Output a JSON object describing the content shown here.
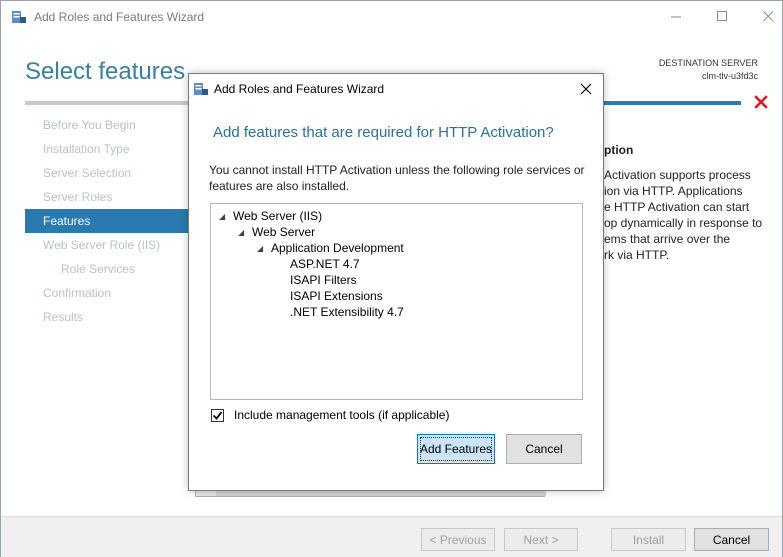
{
  "window": {
    "title": "Add Roles and Features Wizard",
    "controls": {
      "minimize": "minimize-icon",
      "maximize": "maximize-icon",
      "close": "close-icon"
    }
  },
  "header": {
    "page_title": "Select features",
    "destination_label": "DESTINATION SERVER",
    "destination_server": "clm-tlv-u3fd3c"
  },
  "nav": {
    "items": [
      {
        "label": "Before You Begin",
        "active": false,
        "sub": false
      },
      {
        "label": "Installation Type",
        "active": false,
        "sub": false
      },
      {
        "label": "Server Selection",
        "active": false,
        "sub": false
      },
      {
        "label": "Server Roles",
        "active": false,
        "sub": false
      },
      {
        "label": "Features",
        "active": true,
        "sub": false
      },
      {
        "label": "Web Server Role (IIS)",
        "active": false,
        "sub": false
      },
      {
        "label": "Role Services",
        "active": false,
        "sub": true
      },
      {
        "label": "Confirmation",
        "active": false,
        "sub": false
      },
      {
        "label": "Results",
        "active": false,
        "sub": false
      }
    ]
  },
  "description": {
    "title": "ption",
    "lines": [
      "Activation supports process",
      "ion via HTTP. Applications",
      "e HTTP Activation can start",
      "op dynamically in response to",
      "ems that arrive over the",
      "rk via HTTP."
    ]
  },
  "footer": {
    "previous": "< Previous",
    "next": "Next >",
    "install": "Install",
    "cancel": "Cancel"
  },
  "dialog": {
    "title": "Add Roles and Features Wizard",
    "heading": "Add features that are required for HTTP Activation?",
    "text": "You cannot install HTTP Activation unless the following role services or features are also installed.",
    "tree": [
      {
        "label": "Web Server (IIS)",
        "expandable": true
      },
      {
        "label": "Web Server",
        "expandable": true
      },
      {
        "label": "Application Development",
        "expandable": true
      },
      {
        "label": "ASP.NET 4.7",
        "expandable": false
      },
      {
        "label": "ISAPI Filters",
        "expandable": false
      },
      {
        "label": "ISAPI Extensions",
        "expandable": false
      },
      {
        "label": ".NET Extensibility 4.7",
        "expandable": false
      }
    ],
    "include_tools_label": "Include management tools (if applicable)",
    "include_tools_checked": true,
    "add_features": "Add Features",
    "cancel": "Cancel"
  },
  "colors": {
    "accent_blue": "#2a7ab0",
    "title_blue": "#3a7fa0",
    "dialog_heading": "#2c6fa0",
    "error_red": "#e81123",
    "nav_disabled": "#b9c2cc"
  }
}
